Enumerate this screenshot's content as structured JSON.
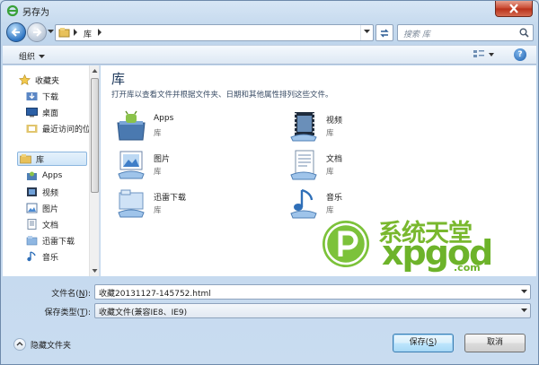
{
  "window": {
    "title": "另存为"
  },
  "address_bar": {
    "crumb": "库"
  },
  "search": {
    "placeholder": "搜索 库"
  },
  "toolbar": {
    "organize_label": "组织",
    "help_label": "?"
  },
  "nav_pane": {
    "items": [
      {
        "label": "收藏夹",
        "icon": "star-icon",
        "indent": 0,
        "selected": false
      },
      {
        "label": "下载",
        "icon": "downloads-folder-icon",
        "indent": 1,
        "selected": false
      },
      {
        "label": "桌面",
        "icon": "desktop-icon",
        "indent": 1,
        "selected": false
      },
      {
        "label": "最近访问的位",
        "icon": "recent-places-icon",
        "indent": 1,
        "selected": false
      },
      {
        "label": "库",
        "icon": "libraries-icon",
        "indent": 0,
        "selected": true
      },
      {
        "label": "Apps",
        "icon": "apps-library-icon",
        "indent": 1,
        "selected": false
      },
      {
        "label": "视频",
        "icon": "videos-library-icon",
        "indent": 1,
        "selected": false
      },
      {
        "label": "图片",
        "icon": "pictures-library-icon",
        "indent": 1,
        "selected": false
      },
      {
        "label": "文档",
        "icon": "documents-library-icon",
        "indent": 1,
        "selected": false
      },
      {
        "label": "迅雷下载",
        "icon": "thunder-download-library-icon",
        "indent": 1,
        "selected": false
      },
      {
        "label": "音乐",
        "icon": "music-library-icon",
        "indent": 1,
        "selected": false
      }
    ]
  },
  "content": {
    "title": "库",
    "description": "打开库以查看文件并根据文件夹、日期和其他属性排列这些文件。",
    "libraries": [
      {
        "name": "Apps",
        "type": "库",
        "icon": "apps-library-icon"
      },
      {
        "name": "视频",
        "type": "库",
        "icon": "videos-library-icon"
      },
      {
        "name": "图片",
        "type": "库",
        "icon": "pictures-library-icon"
      },
      {
        "name": "文档",
        "type": "库",
        "icon": "documents-library-icon"
      },
      {
        "name": "迅雷下载",
        "type": "库",
        "icon": "thunder-download-library-icon"
      },
      {
        "name": "音乐",
        "type": "库",
        "icon": "music-library-icon"
      }
    ]
  },
  "watermark": {
    "cn": "系统天堂",
    "en": "xpgod",
    "domain": ".com"
  },
  "form": {
    "filename_label": "文件名(",
    "filename_key": "N",
    "filename_value": "收藏20131127-145752.html",
    "filetype_label": "保存类型(",
    "filetype_key": "T",
    "filetype_value": "收藏文件(兼容IE8、IE9)"
  },
  "footer": {
    "hide_folders_label": "隐藏文件夹",
    "save_label": "保存(",
    "save_key": "S",
    "cancel_label": "取消"
  },
  "colors": {
    "accent": "#3c7fb1",
    "watermark_green": "#6db32a",
    "title_blue": "#1e395b"
  }
}
